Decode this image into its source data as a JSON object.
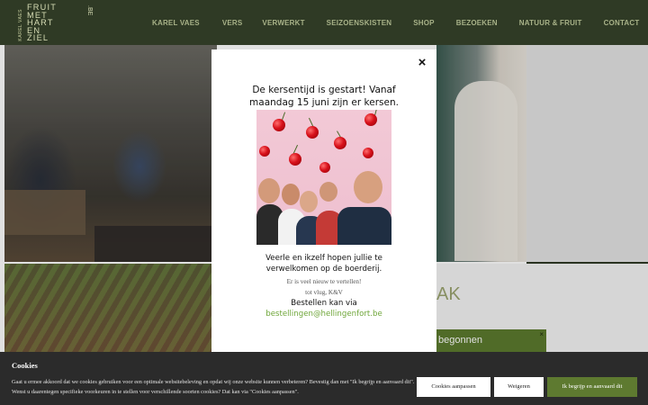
{
  "header": {
    "logo": {
      "top_line": "KAREL VAES",
      "words": [
        "FRUIT",
        "MET",
        "HART",
        "EN",
        "ZIEL"
      ],
      "suffix": ".BE"
    },
    "nav": [
      {
        "label": "KAREL VAES"
      },
      {
        "label": "VERS"
      },
      {
        "label": "VERWERKT"
      },
      {
        "label": "SEIZOENSKISTEN"
      },
      {
        "label": "SHOP"
      },
      {
        "label": "BEZOEKEN"
      },
      {
        "label": "NATUUR & FRUIT"
      },
      {
        "label": "CONTACT"
      }
    ]
  },
  "background": {
    "heading_fragment": "AK",
    "button_fragment": "begonnen",
    "button_close": "×"
  },
  "modal": {
    "close_label": "×",
    "headline_line1": "De kersentijd is gestart! Vanaf",
    "headline_line2": "maandag 15 juni zijn er kersen.",
    "text_line1": "Veerle en ikzelf hopen jullie te",
    "text_line2": "verwelkomen op de boerderij.",
    "note_line1": "Er is veel nieuw te vertellen!",
    "note_line2": "tot vlug, K&V",
    "order_label": "Bestellen kan via",
    "email": "bestellingen@hellingenfort.be"
  },
  "cookies": {
    "title": "Cookies",
    "text": "Gaat u ermee akkoord dat we cookies gebruiken voor een optimale websitebeleving en opdat wij onze website kunnen verbeteren? Bevestig dan met \"Ik begrijp en aanvaard dit\". Wenst u daarentegen specifieke voorkeuren in te stellen voor verschillende soorten cookies? Dat kan via \"Cookies aanpassen\".",
    "customize_label": "Cookies aanpassen",
    "decline_label": "Weigeren",
    "accept_label": "Ik begrijp en aanvaard dit"
  },
  "colors": {
    "header_bg": "#2f3a25",
    "nav_text": "#a8b288",
    "accent_green": "#5e7a30",
    "email_green": "#6fa63a",
    "cookie_bg": "#2b2b2b"
  }
}
